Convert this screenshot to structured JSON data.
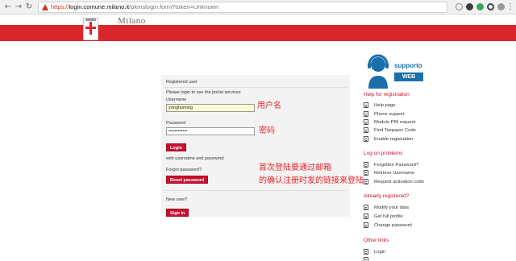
{
  "browser": {
    "url_scheme": "https://",
    "url_host": "login.comune.milano.it",
    "url_path": "/pkmslogin.form?token=Unknown"
  },
  "site": {
    "name": "Milano",
    "brand_red": "#d8262c"
  },
  "login": {
    "section_title": "Registered user",
    "intro": "Please login to use the portal services",
    "username_label": "Username",
    "username_value": "yonghuming",
    "password_label": "Password",
    "password_value": "••••••••••••",
    "login_button": "Login",
    "alt_text": "with username and password",
    "forgot_label": "Forgot password?",
    "reset_button": "Reset password",
    "new_user_label": "New user?",
    "signin_button": "Sign in"
  },
  "annotations": {
    "username_note": "用户名",
    "password_note": "密码",
    "activation_note_line1": "首次登陆要通过邮箱",
    "activation_note_line2": "的确认注册时发的链接来登陆",
    "color": "#e8242a"
  },
  "sidebar": {
    "support_label": "supporto",
    "web_label": "WEB",
    "sections": [
      {
        "heading": "Help for registration",
        "items": [
          "Help page",
          "Phone support",
          "Module PIN request",
          "Find Taxpayer Code",
          "Enable registration"
        ]
      },
      {
        "heading": "Log on problems",
        "items": [
          "Forgotten Password?",
          "Retrieve Username",
          "Request activation code"
        ]
      },
      {
        "heading": "Already registered?",
        "items": [
          "Modify your data",
          "Get full profile",
          "Change password"
        ]
      },
      {
        "heading": "Other links",
        "items": [
          "Login",
          ""
        ]
      }
    ]
  }
}
